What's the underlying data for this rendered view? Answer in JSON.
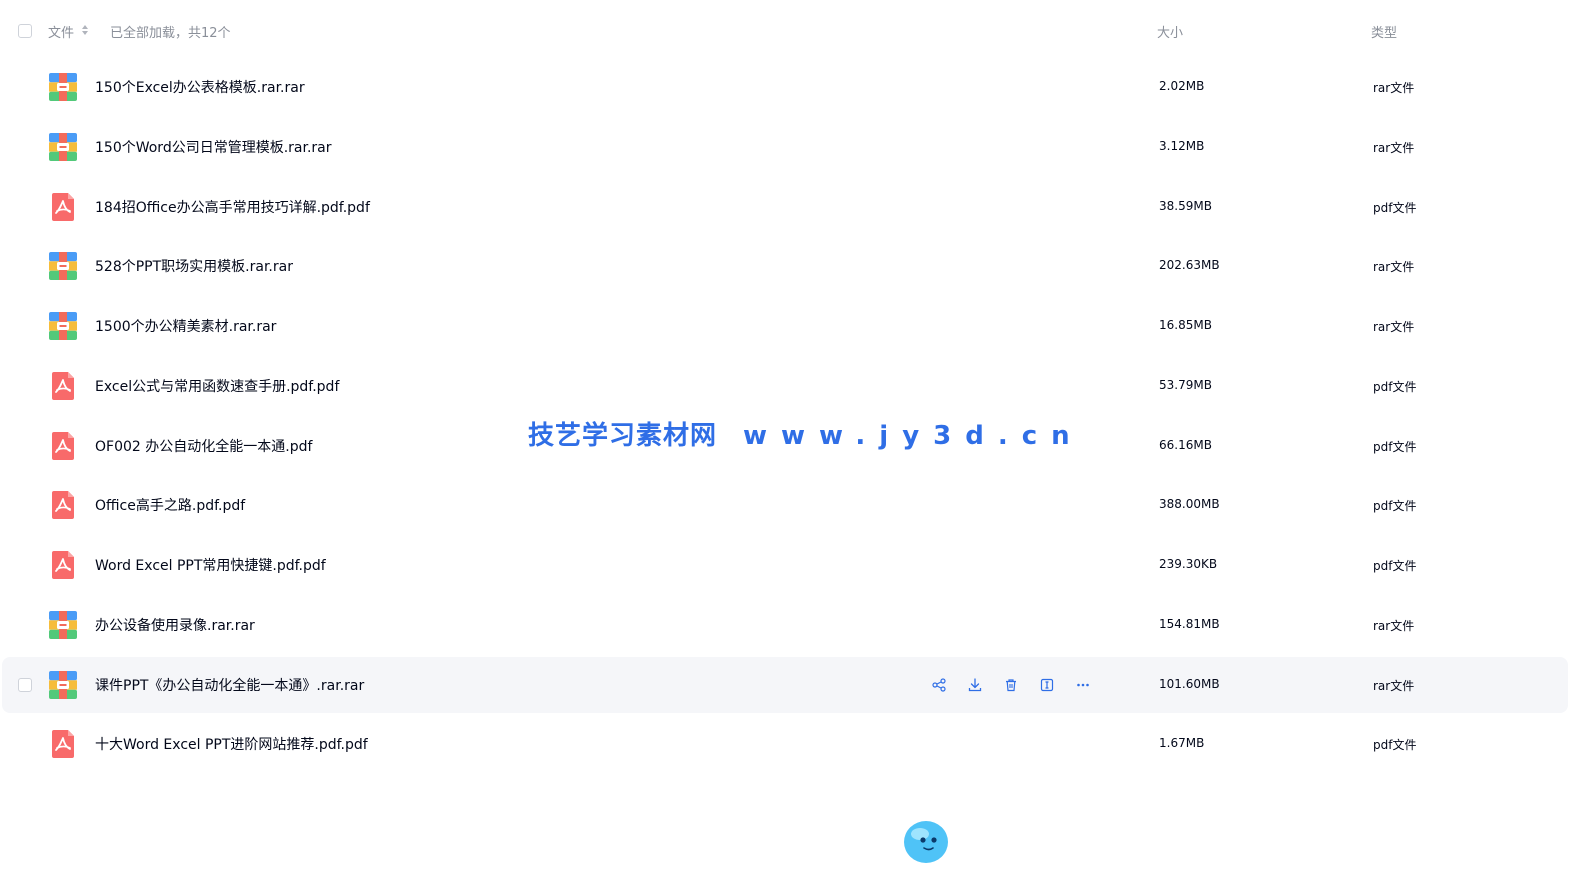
{
  "header": {
    "file_label": "文件",
    "loaded_text": "已全部加载，共12个",
    "size_label": "大小",
    "type_label": "类型"
  },
  "files": [
    {
      "name": "150个Excel办公表格模板.rar.rar",
      "size": "2.02MB",
      "type": "rar文件",
      "icon": "rar-archive-icon"
    },
    {
      "name": "150个Word公司日常管理模板.rar.rar",
      "size": "3.12MB",
      "type": "rar文件",
      "icon": "rar-archive-icon"
    },
    {
      "name": "184招Office办公高手常用技巧详解.pdf.pdf",
      "size": "38.59MB",
      "type": "pdf文件",
      "icon": "pdf-file-icon"
    },
    {
      "name": "528个PPT职场实用模板.rar.rar",
      "size": "202.63MB",
      "type": "rar文件",
      "icon": "rar-archive-icon"
    },
    {
      "name": "1500个办公精美素材.rar.rar",
      "size": "16.85MB",
      "type": "rar文件",
      "icon": "rar-archive-icon"
    },
    {
      "name": "Excel公式与常用函数速查手册.pdf.pdf",
      "size": "53.79MB",
      "type": "pdf文件",
      "icon": "pdf-file-icon"
    },
    {
      "name": "OF002 办公自动化全能一本通.pdf",
      "size": "66.16MB",
      "type": "pdf文件",
      "icon": "pdf-file-icon"
    },
    {
      "name": "Office高手之路.pdf.pdf",
      "size": "388.00MB",
      "type": "pdf文件",
      "icon": "pdf-file-icon"
    },
    {
      "name": "Word Excel PPT常用快捷键.pdf.pdf",
      "size": "239.30KB",
      "type": "pdf文件",
      "icon": "pdf-file-icon"
    },
    {
      "name": "办公设备使用录像.rar.rar",
      "size": "154.81MB",
      "type": "rar文件",
      "icon": "rar-archive-icon"
    },
    {
      "name": "课件PPT《办公自动化全能一本通》.rar.rar",
      "size": "101.60MB",
      "type": "rar文件",
      "icon": "rar-archive-icon"
    },
    {
      "name": "十大Word Excel PPT进阶网站推荐.pdf.pdf",
      "size": "1.67MB",
      "type": "pdf文件",
      "icon": "pdf-file-icon"
    }
  ],
  "hover_row": 10,
  "row_actions": [
    "share-icon",
    "download-icon",
    "delete-icon",
    "rename-icon",
    "more-icon"
  ],
  "watermark": {
    "name": "技艺学习素材网",
    "url": "www.jy3d.cn"
  },
  "colors": {
    "accent": "#2f6ee6",
    "pdf_red": "#f86a6a",
    "text_primary": "#03081a",
    "text_secondary": "#8a8f99",
    "hover_bg": "#f5f6f9"
  }
}
